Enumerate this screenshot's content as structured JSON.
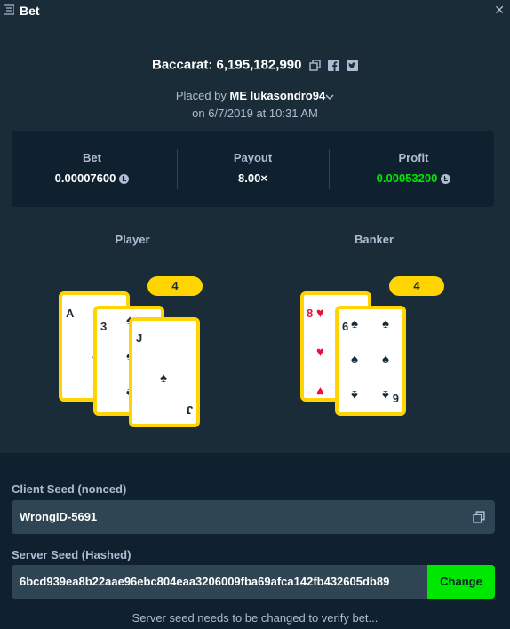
{
  "window": {
    "title": "Bet"
  },
  "game": {
    "title": "Baccarat: 6,195,182,990"
  },
  "placed": {
    "prefix": "Placed by",
    "user": "ME lukasondro94",
    "date": "on 6/7/2019 at 10:31 AM"
  },
  "stats": {
    "bet": {
      "label": "Bet",
      "value": "0.00007600"
    },
    "payout": {
      "label": "Payout",
      "value": "8.00×"
    },
    "profit": {
      "label": "Profit",
      "value": "0.00053200"
    },
    "coin_symbol": "Ł"
  },
  "player": {
    "label": "Player",
    "total": "4",
    "cards": [
      {
        "rank": "A",
        "suit": "spades"
      },
      {
        "rank": "3",
        "suit": "spades"
      },
      {
        "rank": "J",
        "suit": "spades"
      }
    ]
  },
  "banker": {
    "label": "Banker",
    "total": "4",
    "cards": [
      {
        "rank": "8",
        "suit": "hearts"
      },
      {
        "rank": "6",
        "suit": "spades"
      },
      {
        "rank": "9",
        "suit": "spades"
      }
    ]
  },
  "seeds": {
    "client_label": "Client Seed (nonced)",
    "client_value": "WrongID-5691",
    "server_label": "Server Seed (Hashed)",
    "server_value": "6bcd939ea8b22aae96ebc804eaa3206009fba69afca142fb432605db89",
    "change_label": "Change",
    "note": "Server seed needs to be changed to verify bet..."
  },
  "colors": {
    "accent_green": "#00e701",
    "badge_yellow": "#ffd400",
    "bg": "#1a2c38",
    "panel": "#0f212e",
    "red_suit": "#e9113c"
  },
  "icons": [
    "list-icon",
    "close-icon",
    "copy-icon",
    "facebook-icon",
    "twitter-icon",
    "chevron-down-icon",
    "litecoin-icon",
    "spade-icon",
    "heart-icon"
  ]
}
